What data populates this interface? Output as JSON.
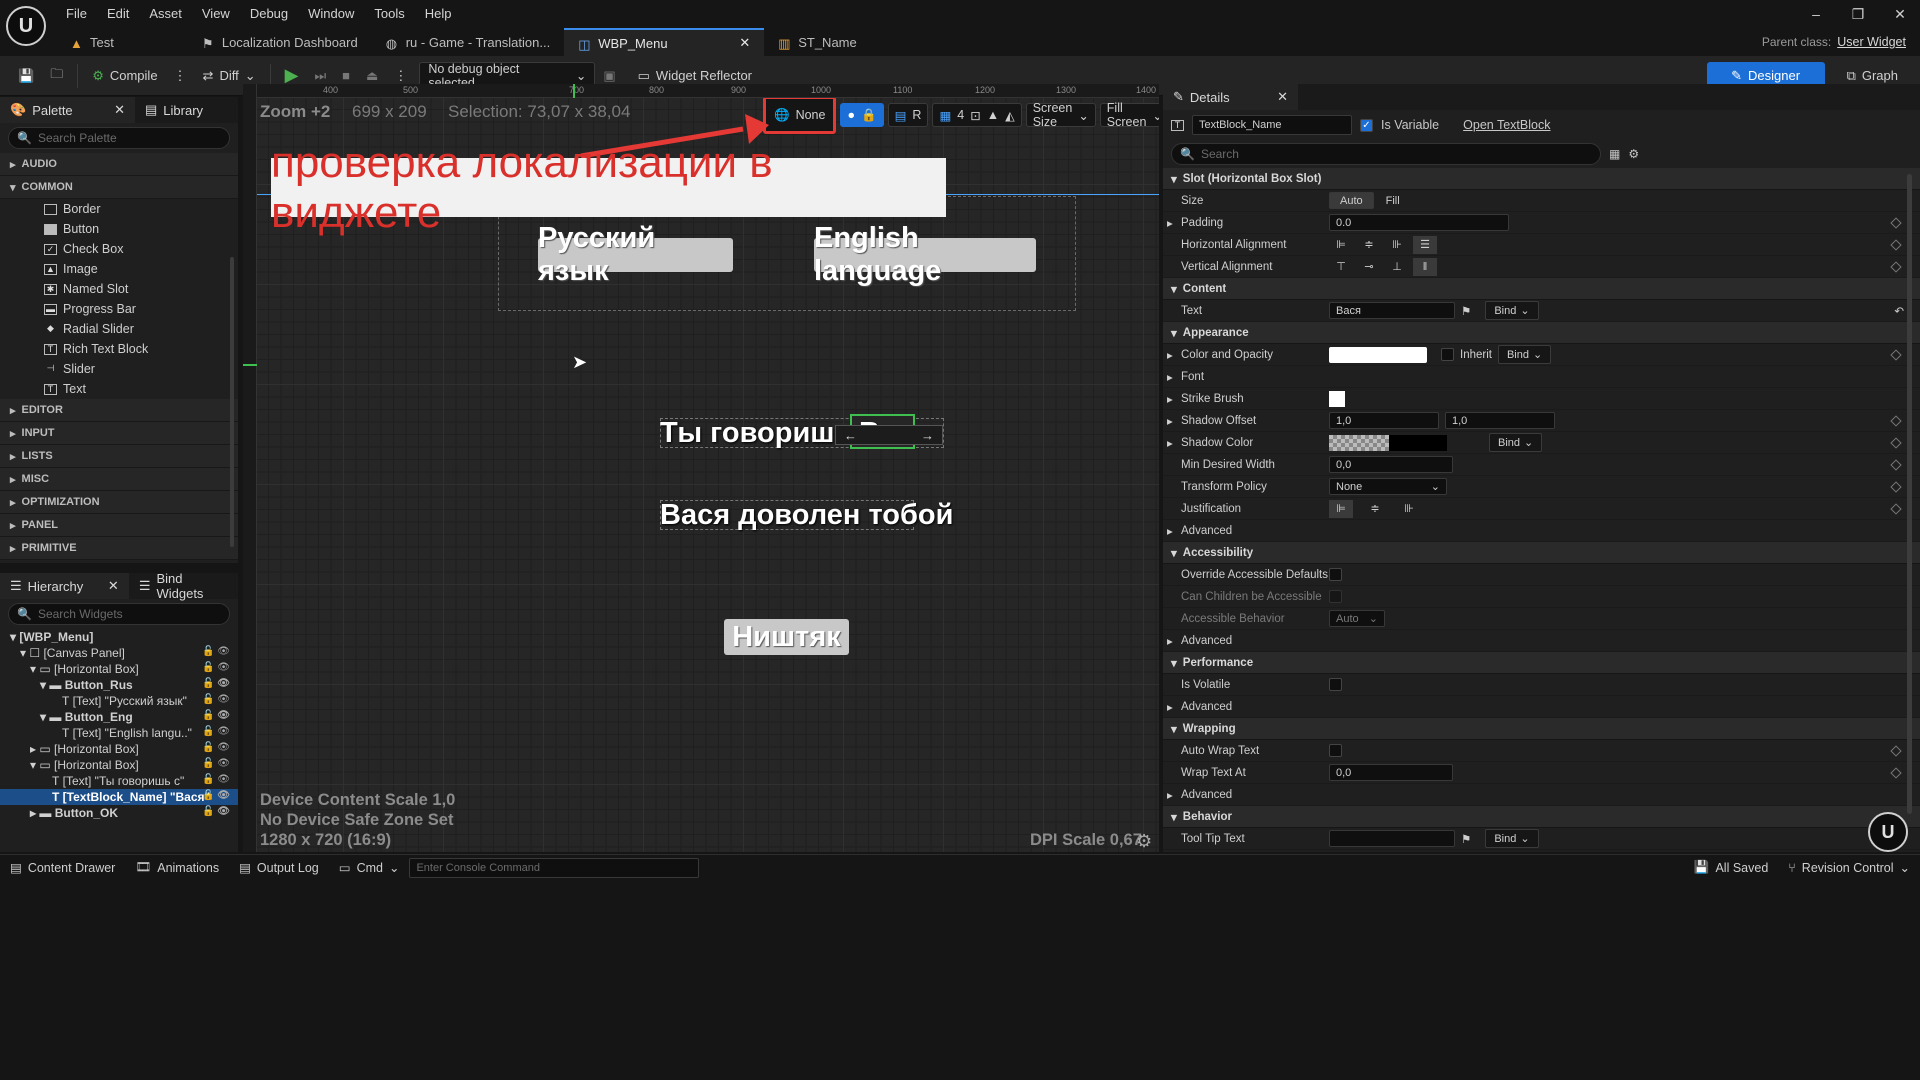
{
  "menu": {
    "items": [
      "File",
      "Edit",
      "Asset",
      "View",
      "Debug",
      "Window",
      "Tools",
      "Help"
    ],
    "parent_class_label": "Parent class:",
    "parent_class_value": "User Widget"
  },
  "tabs": [
    {
      "label": "Test",
      "icon": "level-icon"
    },
    {
      "label": "Localization Dashboard",
      "icon": "dashboard-icon"
    },
    {
      "label": "ru - Game - Translation...",
      "icon": "translation-icon"
    },
    {
      "label": "WBP_Menu",
      "icon": "widget-blueprint-icon",
      "active": true
    },
    {
      "label": "ST_Name",
      "icon": "string-table-icon"
    }
  ],
  "toolbar": {
    "compile": "Compile",
    "diff": "Diff",
    "debug_object": "No debug object selected",
    "widget_reflector": "Widget Reflector",
    "designer": "Designer",
    "graph": "Graph"
  },
  "palette": {
    "tab": "Palette",
    "library_tab": "Library",
    "search_placeholder": "Search Palette",
    "categories_top": [
      "AUDIO",
      "COMMON"
    ],
    "common_items": [
      {
        "label": "Border",
        "icon": "border-icon"
      },
      {
        "label": "Button",
        "icon": "button-icon"
      },
      {
        "label": "Check Box",
        "icon": "checkbox-icon"
      },
      {
        "label": "Image",
        "icon": "image-icon"
      },
      {
        "label": "Named Slot",
        "icon": "named-slot-icon"
      },
      {
        "label": "Progress Bar",
        "icon": "progress-bar-icon"
      },
      {
        "label": "Radial Slider",
        "icon": "radial-slider-icon"
      },
      {
        "label": "Rich Text Block",
        "icon": "rich-text-icon"
      },
      {
        "label": "Slider",
        "icon": "slider-icon"
      },
      {
        "label": "Text",
        "icon": "text-icon"
      }
    ],
    "categories_bottom": [
      "EDITOR",
      "INPUT",
      "LISTS",
      "MISC",
      "OPTIMIZATION",
      "PANEL",
      "PRIMITIVE"
    ]
  },
  "hierarchy": {
    "tab": "Hierarchy",
    "bind_tab": "Bind Widgets",
    "search_placeholder": "Search Widgets",
    "rows": [
      {
        "label": "[WBP_Menu]",
        "indent": 0,
        "bold": true
      },
      {
        "label": "[Canvas Panel]",
        "indent": 1
      },
      {
        "label": "[Horizontal Box]",
        "indent": 2
      },
      {
        "label": "Button_Rus",
        "indent": 3,
        "bold": true
      },
      {
        "label": "[Text] \"Русский язык\"",
        "indent": 4
      },
      {
        "label": "Button_Eng",
        "indent": 3,
        "bold": true
      },
      {
        "label": "[Text] \"English langu..\"",
        "indent": 4
      },
      {
        "label": "[Horizontal Box]",
        "indent": 2
      },
      {
        "label": "[Horizontal Box]",
        "indent": 2
      },
      {
        "label": "[Text] \"Ты говоришь с\"",
        "indent": 3
      },
      {
        "label": "[TextBlock_Name] \"Вася\"",
        "indent": 3,
        "selected": true
      },
      {
        "label": "Button_OK",
        "indent": 2,
        "bold": true
      }
    ]
  },
  "viewport": {
    "zoom": "Zoom +2",
    "size": "699 x 209",
    "selection": "Selection: 73,07 x 38,04",
    "culture": "None",
    "r_label": "R",
    "grid_snap": "4",
    "screen_size": "Screen Size",
    "fill_screen": "Fill Screen",
    "ruler_ticks": [
      "400",
      "500",
      "700",
      "800",
      "900",
      "1000",
      "1100",
      "1200",
      "1300",
      "1400"
    ],
    "annotation": "проверка локализации в виджете",
    "btn_rus": "Русский язык",
    "btn_eng": "English language",
    "line1_prefix": "Ты говоришь с",
    "line1_name": "Вася",
    "line2": "Вася  доволен тобой",
    "btn_ok": "Ништяк",
    "device_scale": "Device Content Scale 1,0",
    "safe_zone": "No Device Safe Zone Set",
    "resolution": "1280 x 720 (16:9)",
    "dpi": "DPI Scale 0,67"
  },
  "details": {
    "tab": "Details",
    "name": "TextBlock_Name",
    "is_variable": "Is Variable",
    "open_link": "Open TextBlock",
    "search_placeholder": "Search",
    "slot_section": "Slot (Horizontal Box Slot)",
    "size_label": "Size",
    "size_auto": "Auto",
    "size_fill": "Fill",
    "padding_label": "Padding",
    "padding_value": "0.0",
    "halign_label": "Horizontal Alignment",
    "valign_label": "Vertical Alignment",
    "content_section": "Content",
    "text_label": "Text",
    "text_value": "Вася",
    "bind": "Bind",
    "appearance_section": "Appearance",
    "color_label": "Color and Opacity",
    "inherit": "Inherit",
    "font_label": "Font",
    "strike_label": "Strike Brush",
    "shadow_offset_label": "Shadow Offset",
    "shadow_offset_x": "1,0",
    "shadow_offset_y": "1,0",
    "shadow_color_label": "Shadow Color",
    "min_width_label": "Min Desired Width",
    "min_width_value": "0,0",
    "transform_label": "Transform Policy",
    "transform_value": "None",
    "justification_label": "Justification",
    "advanced": "Advanced",
    "accessibility_section": "Accessibility",
    "override_label": "Override Accessible Defaults",
    "children_label": "Can Children be Accessible",
    "behavior_acc_label": "Accessible Behavior",
    "behavior_acc_value": "Auto",
    "performance_section": "Performance",
    "volatile_label": "Is Volatile",
    "wrapping_section": "Wrapping",
    "autowrap_label": "Auto Wrap Text",
    "wrapat_label": "Wrap Text At",
    "wrapat_value": "0,0",
    "behavior_section": "Behavior",
    "tooltip_label": "Tool Tip Text"
  },
  "statusbar": {
    "content_drawer": "Content Drawer",
    "animations": "Animations",
    "output_log": "Output Log",
    "cmd": "Cmd",
    "console_placeholder": "Enter Console Command",
    "all_saved": "All Saved",
    "revision": "Revision Control"
  },
  "colors": {
    "accent": "#3b8ded",
    "designer_button": "#1b6fd6",
    "annotation_red": "#e53935",
    "selection_blue": "#1c4f8a"
  }
}
